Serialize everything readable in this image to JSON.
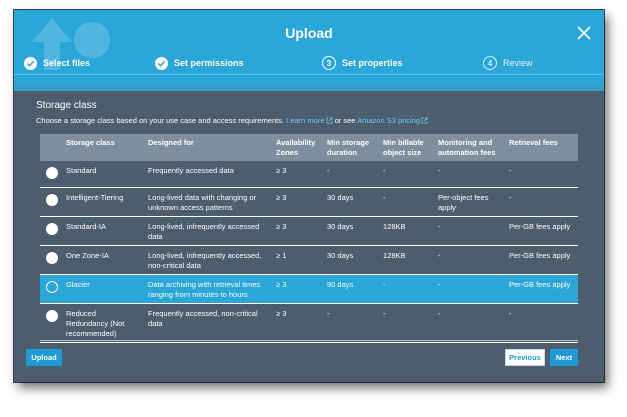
{
  "window": {
    "title": "Upload"
  },
  "steps": [
    {
      "label": "Select files",
      "state": "done",
      "icon": "check-icon"
    },
    {
      "label": "Set permissions",
      "state": "done",
      "icon": "check-icon"
    },
    {
      "label": "Set properties",
      "state": "current",
      "number": "3"
    },
    {
      "label": "Review",
      "state": "todo",
      "number": "4"
    }
  ],
  "section": {
    "title": "Storage class",
    "description": "Choose a storage class based on your use case and access requirements.",
    "learn_more": "Learn more",
    "or_see": "or see",
    "pricing_link": "Amazon S3 pricing"
  },
  "table": {
    "headers": {
      "storage_class": "Storage class",
      "designed_for": "Designed for",
      "availability_zones": "Availability Zones",
      "min_duration": "Min storage duration",
      "min_size": "Min billable object size",
      "monitoring": "Monitoring and automation fees",
      "retrieval": "Retrieval fees"
    },
    "rows": [
      {
        "name": "Standard",
        "designed": "Frequently accessed data",
        "az": "≥ 3",
        "duration": "-",
        "size": "-",
        "monitoring": "-",
        "retrieval": "-",
        "selected": false
      },
      {
        "name": "Intelligent-Tiering",
        "designed": "Long-lived data with changing or unknown access patterns",
        "az": "≥ 3",
        "duration": "30 days",
        "size": "-",
        "monitoring": "Per-object fees apply",
        "retrieval": "-",
        "selected": false
      },
      {
        "name": "Standard-IA",
        "designed": "Long-lived, infrequently accessed data",
        "az": "≥ 3",
        "duration": "30 days",
        "size": "128KB",
        "monitoring": "-",
        "retrieval": "Per-GB fees apply",
        "selected": false
      },
      {
        "name": "One Zone-IA",
        "designed": "Long-lived, infrequently accessed, non-critical data",
        "az": "≥ 1",
        "duration": "30 days",
        "size": "128KB",
        "monitoring": "-",
        "retrieval": "Per-GB fees apply",
        "selected": false
      },
      {
        "name": "Glacier",
        "designed": "Data archiving with retrieval times ranging from minutes to hours",
        "az": "≥ 3",
        "duration": "90 days",
        "size": "-",
        "monitoring": "-",
        "retrieval": "Per-GB fees apply",
        "selected": true
      },
      {
        "name": "Reduced Redundancy (Not recommended)",
        "designed": "Frequently accessed, non-critical data",
        "az": "≥ 3",
        "duration": "-",
        "size": "-",
        "monitoring": "-",
        "retrieval": "-",
        "selected": false
      }
    ]
  },
  "footer": {
    "upload_label": "Upload",
    "previous_label": "Previous",
    "next_label": "Next"
  },
  "colors": {
    "accent": "#2aa6d8",
    "panel": "#4c5d6d",
    "table_header": "#7d8e9c",
    "link": "#6fd0f6"
  }
}
